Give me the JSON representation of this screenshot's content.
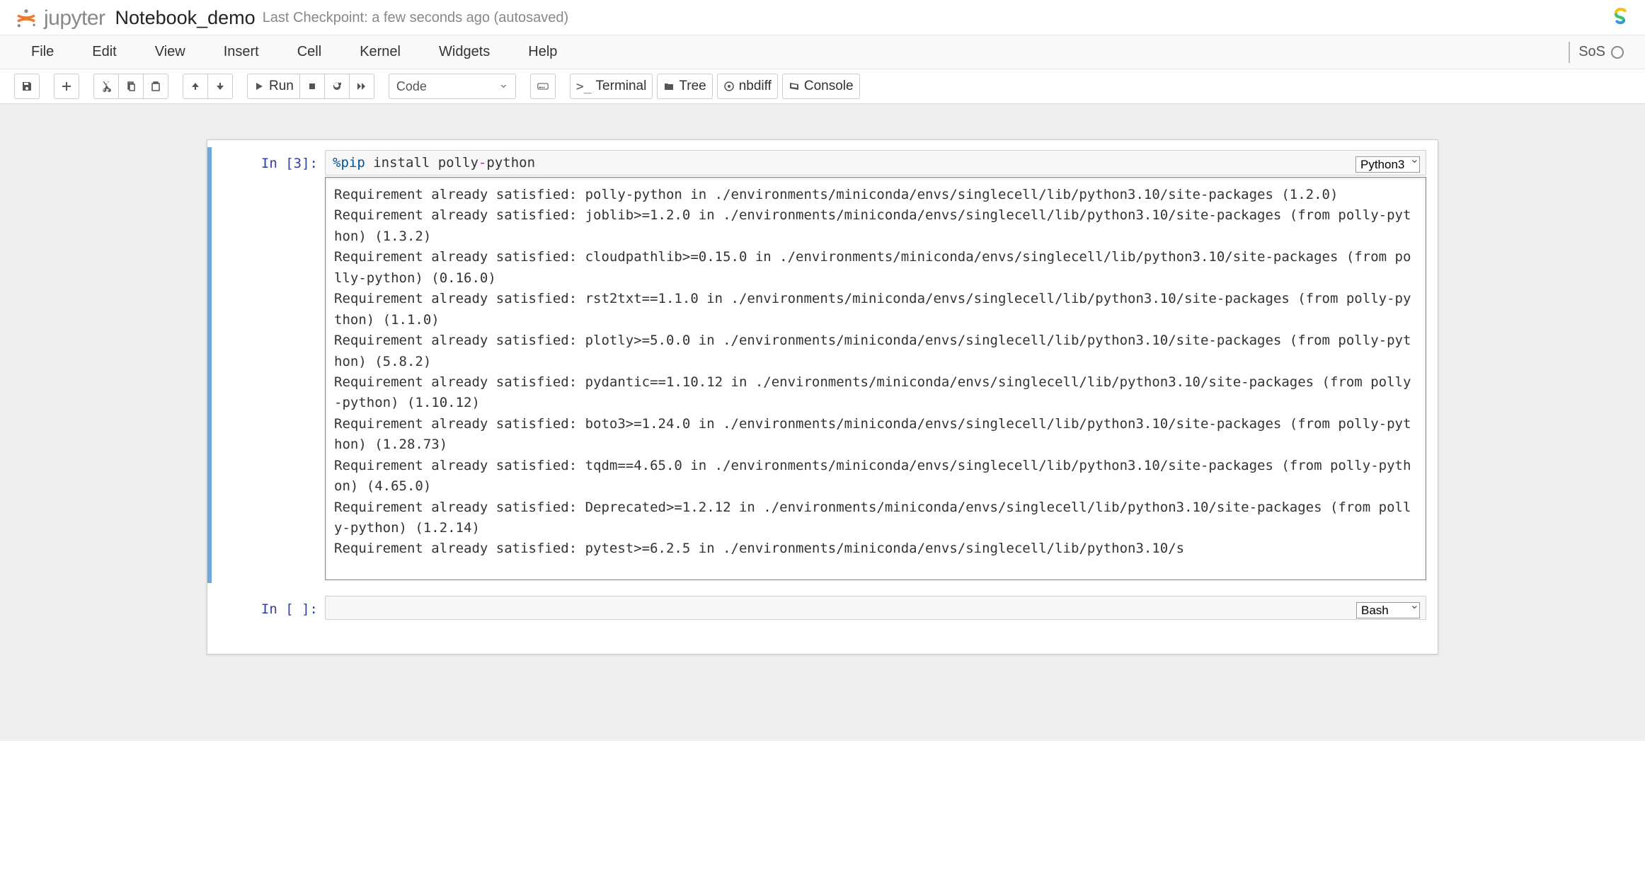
{
  "header": {
    "logo_text": "jupyter",
    "notebook_name": "Notebook_demo",
    "checkpoint": "Last Checkpoint: a few seconds ago  (autosaved)"
  },
  "menubar": {
    "items": [
      "File",
      "Edit",
      "View",
      "Insert",
      "Cell",
      "Kernel",
      "Widgets",
      "Help"
    ],
    "kernel_name": "SoS"
  },
  "toolbar": {
    "run_label": "Run",
    "celltype_selected": "Code",
    "terminal_label": "Terminal",
    "tree_label": "Tree",
    "nbdiff_label": "nbdiff",
    "console_label": "Console"
  },
  "cells": [
    {
      "prompt": "In [3]:",
      "code_magic": "%pip",
      "code_rest": " install polly",
      "code_op": "-",
      "code_tail": "python",
      "kernel": "Python3",
      "output": "Requirement already satisfied: polly-python in ./environments/miniconda/envs/singlecell/lib/python3.10/site-packages (1.2.0)\nRequirement already satisfied: joblib>=1.2.0 in ./environments/miniconda/envs/singlecell/lib/python3.10/site-packages (from polly-python) (1.3.2)\nRequirement already satisfied: cloudpathlib>=0.15.0 in ./environments/miniconda/envs/singlecell/lib/python3.10/site-packages (from polly-python) (0.16.0)\nRequirement already satisfied: rst2txt==1.1.0 in ./environments/miniconda/envs/singlecell/lib/python3.10/site-packages (from polly-python) (1.1.0)\nRequirement already satisfied: plotly>=5.0.0 in ./environments/miniconda/envs/singlecell/lib/python3.10/site-packages (from polly-python) (5.8.2)\nRequirement already satisfied: pydantic==1.10.12 in ./environments/miniconda/envs/singlecell/lib/python3.10/site-packages (from polly-python) (1.10.12)\nRequirement already satisfied: boto3>=1.24.0 in ./environments/miniconda/envs/singlecell/lib/python3.10/site-packages (from polly-python) (1.28.73)\nRequirement already satisfied: tqdm==4.65.0 in ./environments/miniconda/envs/singlecell/lib/python3.10/site-packages (from polly-python) (4.65.0)\nRequirement already satisfied: Deprecated>=1.2.12 in ./environments/miniconda/envs/singlecell/lib/python3.10/site-packages (from polly-python) (1.2.14)\nRequirement already satisfied: pytest>=6.2.5 in ./environments/miniconda/envs/singlecell/lib/python3.10/s"
    },
    {
      "prompt": "In [ ]:",
      "code": "",
      "kernel": "Bash"
    }
  ]
}
